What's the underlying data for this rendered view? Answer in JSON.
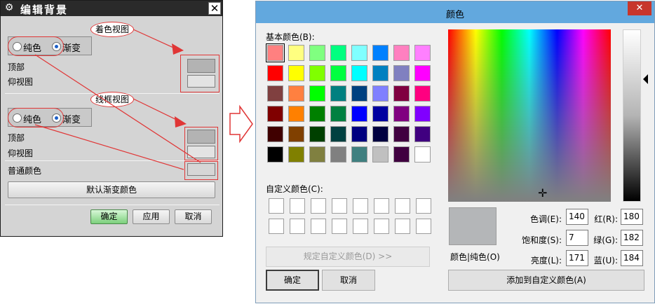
{
  "left_dialog": {
    "title": "编辑背景",
    "shaded_view_callout": "着色视图",
    "wireframe_view_callout": "线框视图",
    "shaded": {
      "plain_label": "纯色",
      "gradient_label": "渐变",
      "selected": "gradient",
      "top_label": "顶部",
      "bottom_label": "仰视图"
    },
    "wireframe": {
      "plain_label": "纯色",
      "gradient_label": "渐变",
      "selected": "gradient",
      "top_label": "顶部",
      "bottom_label": "仰视图"
    },
    "general_color_label": "普通颜色",
    "default_gradient_button": "默认渐变颜色",
    "ok_button": "确定",
    "apply_button": "应用",
    "cancel_button": "取消"
  },
  "color_dialog": {
    "title": "颜色",
    "close_label": "✕",
    "basic_colors_label": "基本颜色(B):",
    "basic_colors": [
      [
        "#ff8080",
        "#ffff80",
        "#80ff80",
        "#00ff80",
        "#80ffff",
        "#0080ff",
        "#ff80c0",
        "#ff80ff"
      ],
      [
        "#ff0000",
        "#ffff00",
        "#80ff00",
        "#00ff40",
        "#00ffff",
        "#0080c0",
        "#8080c0",
        "#ff00ff"
      ],
      [
        "#804040",
        "#ff8040",
        "#00ff00",
        "#008080",
        "#004080",
        "#8080ff",
        "#800040",
        "#ff0080"
      ],
      [
        "#800000",
        "#ff8000",
        "#008000",
        "#008040",
        "#0000ff",
        "#0000a0",
        "#800080",
        "#8000ff"
      ],
      [
        "#400000",
        "#804000",
        "#004000",
        "#004040",
        "#000080",
        "#000040",
        "#400040",
        "#400080"
      ],
      [
        "#000000",
        "#808000",
        "#808040",
        "#808080",
        "#408080",
        "#c0c0c0",
        "#400040",
        "#ffffff"
      ]
    ],
    "custom_colors_label": "自定义颜色(C):",
    "define_custom_button": "规定自定义颜色(D) >>",
    "ok_button": "确定",
    "cancel_button": "取消",
    "color_solid_label": "颜色|纯色(O)",
    "current_color": "#b4b6b8",
    "hue_label": "色调(E):",
    "hue_value": "140",
    "sat_label": "饱和度(S):",
    "sat_value": "7",
    "lum_label": "亮度(L):",
    "lum_value": "171",
    "red_label": "红(R):",
    "red_value": "180",
    "green_label": "绿(G):",
    "green_value": "182",
    "blue_label": "蓝(U):",
    "blue_value": "184",
    "add_custom_button": "添加到自定义颜色(A)"
  },
  "colors": {
    "annotation_red": "#e03636",
    "title_blue": "#62a8de",
    "ok_green": "#7cd07c"
  }
}
